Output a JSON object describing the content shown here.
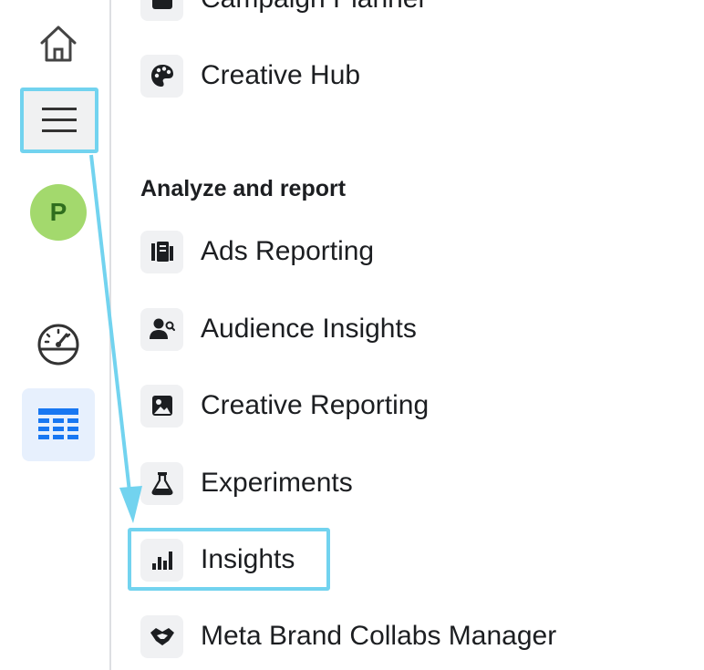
{
  "rail": {
    "avatar_letter": "P",
    "icons": [
      "home-icon",
      "menu-icon",
      "gauge-icon",
      "table-grid-icon"
    ]
  },
  "menu": {
    "top_partial_item": "Campaign Planner",
    "creative_hub": "Creative Hub",
    "section_title": "Analyze and report",
    "items": [
      {
        "label": "Ads Reporting",
        "icon": "ads-reporting-icon"
      },
      {
        "label": "Audience Insights",
        "icon": "audience-insights-icon"
      },
      {
        "label": "Creative Reporting",
        "icon": "creative-reporting-icon"
      },
      {
        "label": "Experiments",
        "icon": "flask-icon"
      },
      {
        "label": "Insights",
        "icon": "bar-chart-icon"
      },
      {
        "label": "Meta Brand Collabs Manager",
        "icon": "handshake-icon"
      }
    ]
  },
  "annotation": {
    "highlight_color": "#72d3ef",
    "highlighted": [
      "menu-button",
      "insights-item"
    ]
  }
}
